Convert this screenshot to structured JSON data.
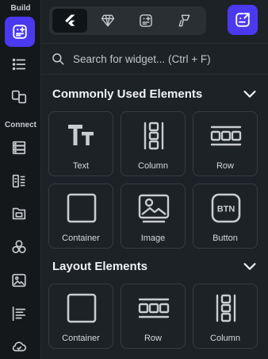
{
  "rail": {
    "build_label": "Build",
    "connect_label": "Connect",
    "items": [
      {
        "icon": "widget-add-icon",
        "active": true
      },
      {
        "icon": "list-tree-icon",
        "active": false
      },
      {
        "icon": "page-swap-icon",
        "active": false
      },
      {
        "icon": "database-icon",
        "active": false
      },
      {
        "icon": "api-icon",
        "active": false
      },
      {
        "icon": "folder-icon",
        "active": false
      },
      {
        "icon": "integrations-icon",
        "active": false
      },
      {
        "icon": "media-icon",
        "active": false
      },
      {
        "icon": "text-align-icon",
        "active": false
      },
      {
        "icon": "cloud-check-icon",
        "active": false
      }
    ]
  },
  "panel": {
    "tabs": [
      {
        "icon": "flutter-icon",
        "active": true
      },
      {
        "icon": "gem-icon",
        "active": false
      },
      {
        "icon": "custom-widget-icon",
        "active": false
      },
      {
        "icon": "theme-icon",
        "active": false
      }
    ],
    "corner_button_icon": "export-widget-icon",
    "search": {
      "placeholder": "Search for widget... (Ctrl + F)",
      "value": ""
    },
    "sections": [
      {
        "title": "Commonly Used Elements",
        "expanded": true,
        "items": [
          {
            "label": "Text",
            "icon": "text-icon"
          },
          {
            "label": "Column",
            "icon": "column-icon"
          },
          {
            "label": "Row",
            "icon": "row-icon"
          },
          {
            "label": "Container",
            "icon": "container-icon"
          },
          {
            "label": "Image",
            "icon": "image-icon"
          },
          {
            "label": "Button",
            "icon": "button-icon",
            "icon_text": "BTN"
          }
        ]
      },
      {
        "title": "Layout Elements",
        "expanded": true,
        "items": [
          {
            "label": "Container",
            "icon": "container-icon"
          },
          {
            "label": "Row",
            "icon": "row-icon"
          },
          {
            "label": "Column",
            "icon": "column-icon"
          }
        ]
      }
    ]
  },
  "colors": {
    "accent": "#4b39ef",
    "background": "#14181b",
    "panel": "#1d2226"
  }
}
